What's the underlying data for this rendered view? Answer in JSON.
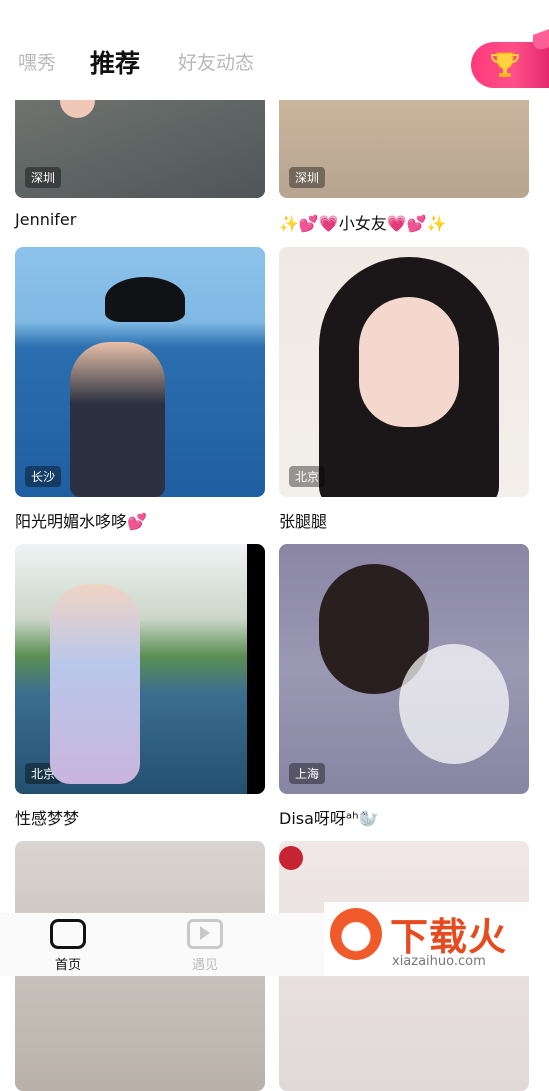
{
  "tabs": [
    {
      "label": "嘿秀"
    },
    {
      "label": "推荐"
    },
    {
      "label": "好友动态"
    }
  ],
  "feed": {
    "items": [
      {
        "name": "Jennifer",
        "city": "深圳"
      },
      {
        "name": "✨💕💗小女友💗💕✨",
        "city": "深圳"
      },
      {
        "name": "阳光明媚水哆哆💕",
        "city": "长沙"
      },
      {
        "name": "张腿腿",
        "city": "北京"
      },
      {
        "name": "性感梦梦",
        "city": "北京"
      },
      {
        "name": "Disa呀呀ᵃʰ🦭",
        "city": "上海"
      }
    ]
  },
  "bottom_nav": [
    {
      "label": "首页"
    },
    {
      "label": "遇见"
    }
  ],
  "watermark": {
    "title": "下载火",
    "sub": "xiazaihuo.com"
  }
}
